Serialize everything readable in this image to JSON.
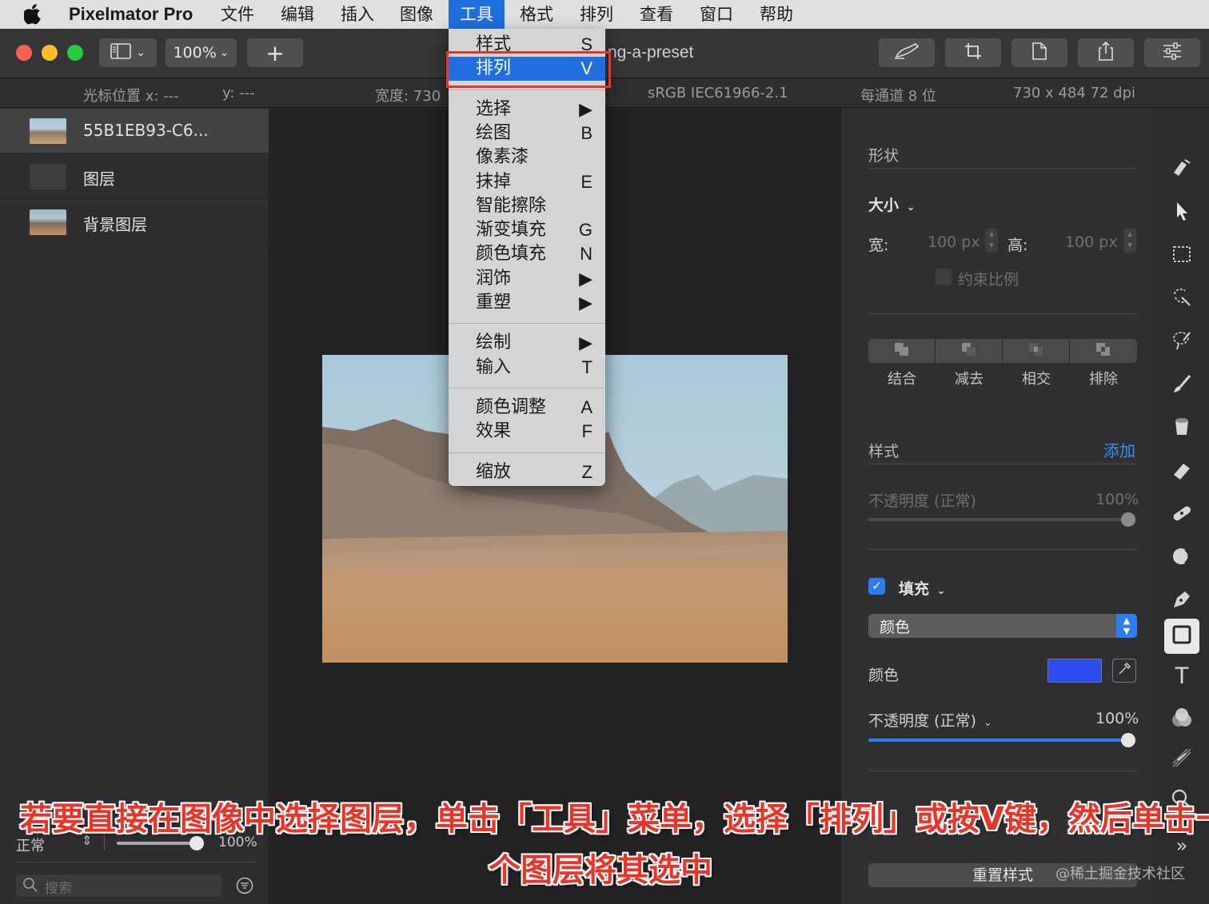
{
  "menubar": {
    "app_name": "Pixelmator Pro",
    "items": [
      "文件",
      "编辑",
      "插入",
      "图像",
      "工具",
      "格式",
      "排列",
      "查看",
      "窗口",
      "帮助"
    ],
    "active": "工具"
  },
  "toolbar": {
    "zoom": "100%",
    "add": "+",
    "doc_title": "ng-a-preset"
  },
  "infobar": {
    "cursor_x": "光标位置 x:  ---",
    "cursor_y": "y:  ---",
    "width": "宽度:  730",
    "color_profile": "sRGB IEC61966-2.1",
    "bit_depth": "每通道 8 位",
    "dimensions": "730 x 484 72 dpi"
  },
  "layers": {
    "items": [
      {
        "name": "55B1EB93-C6..."
      },
      {
        "name": "图层"
      },
      {
        "name": "背景图层"
      }
    ],
    "blend_mode": "正常",
    "opacity": "100%",
    "opacity_value": 1.0,
    "search_placeholder": "搜索"
  },
  "inspector": {
    "shape_title": "形状",
    "size_label": "大小",
    "width_label": "宽:",
    "width_value": "100 px",
    "height_label": "高:",
    "height_value": "100 px",
    "constrain": "约束比例",
    "boolean_ops": [
      "结合",
      "减去",
      "相交",
      "排除"
    ],
    "style_title": "样式",
    "add": "添加",
    "opacity_label_muted": "不透明度 (正常)",
    "opacity_value_muted": "100%",
    "fill_label": "填充",
    "fill_type": "颜色",
    "color_label": "颜色",
    "fill_color": "#2a4cf0",
    "opacity_label": "不透明度 (正常)",
    "opacity_value": "100%",
    "fill_opacity_value": 1.0,
    "reset": "重置样式"
  },
  "dropdown": {
    "groups": [
      [
        {
          "label": "样式",
          "shortcut": "S"
        },
        {
          "label": "排列",
          "shortcut": "V",
          "highlighted": true
        }
      ],
      [
        {
          "label": "选择",
          "shortcut": "▶"
        },
        {
          "label": "绘图",
          "shortcut": "B"
        },
        {
          "label": "像素漆",
          "shortcut": ""
        },
        {
          "label": "抹掉",
          "shortcut": "E"
        },
        {
          "label": "智能擦除",
          "shortcut": ""
        },
        {
          "label": "渐变填充",
          "shortcut": "G"
        },
        {
          "label": "颜色填充",
          "shortcut": "N"
        },
        {
          "label": "润饰",
          "shortcut": "▶"
        },
        {
          "label": "重塑",
          "shortcut": "▶"
        }
      ],
      [
        {
          "label": "绘制",
          "shortcut": "▶"
        },
        {
          "label": "输入",
          "shortcut": "T"
        }
      ],
      [
        {
          "label": "颜色调整",
          "shortcut": "A"
        },
        {
          "label": "效果",
          "shortcut": "F"
        }
      ],
      [
        {
          "label": "缩放",
          "shortcut": "Z"
        }
      ]
    ]
  },
  "caption": {
    "line1": "若要直接在图像中选择图层，单击「工具」菜单，选择「排列」或按V键，然后单击一",
    "line2": "个图层将其选中"
  },
  "watermark": "@稀土掘金技术社区",
  "colors": {
    "accent": "#1f6fe0",
    "highlight_box": "#e8352a"
  }
}
